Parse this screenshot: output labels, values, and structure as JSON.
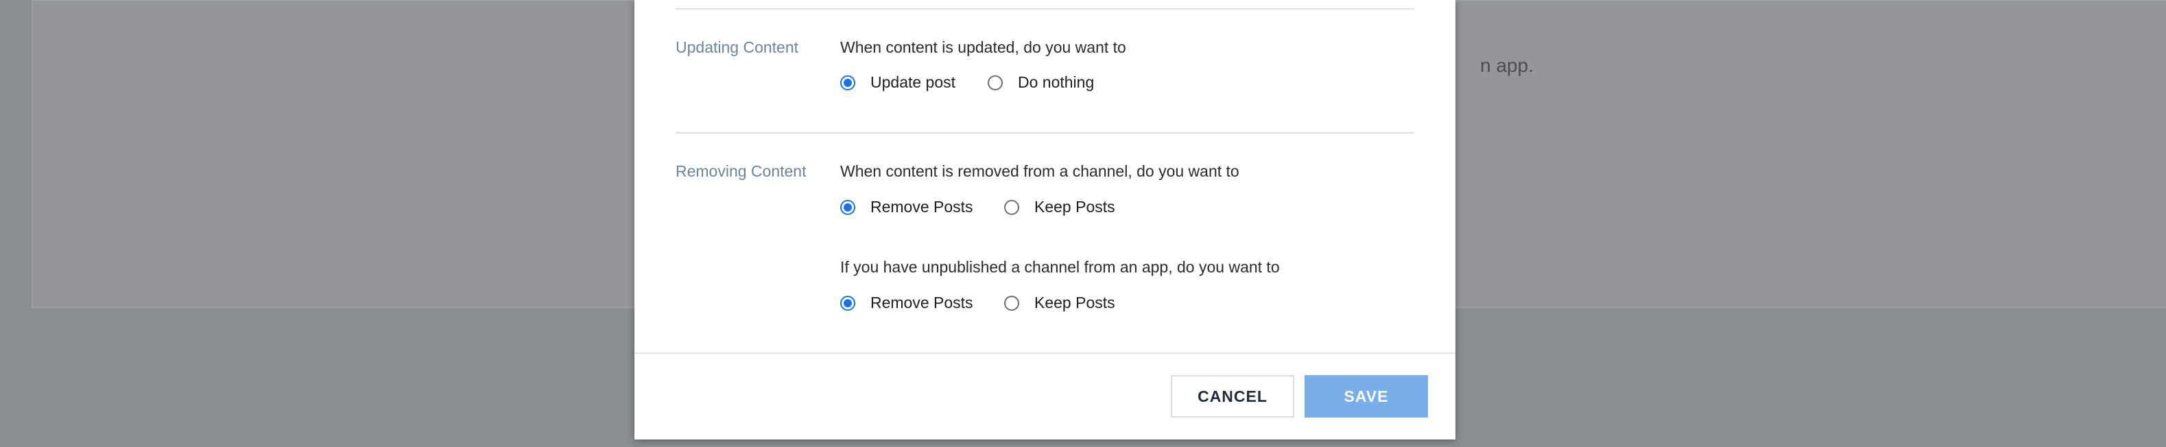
{
  "background": {
    "text_fragment": "n app."
  },
  "modal": {
    "updating": {
      "label": "Updating Content",
      "question": "When content is updated, do you want to",
      "options": [
        {
          "label": "Update post",
          "checked": true
        },
        {
          "label": "Do nothing",
          "checked": false
        }
      ]
    },
    "removing": {
      "label": "Removing Content",
      "question": "When content is removed from a channel, do you want to",
      "options": [
        {
          "label": "Remove Posts",
          "checked": true
        },
        {
          "label": "Keep Posts",
          "checked": false
        }
      ],
      "question2": "If you have unpublished a channel from an app, do you want to",
      "options2": [
        {
          "label": "Remove Posts",
          "checked": true
        },
        {
          "label": "Keep Posts",
          "checked": false
        }
      ]
    },
    "footer": {
      "cancel_label": "CANCEL",
      "save_label": "SAVE"
    }
  },
  "colors": {
    "accent": "#1a73e8",
    "save_button": "#78aeea",
    "section_label": "#6e8497",
    "overlay": "#8a8d91"
  }
}
